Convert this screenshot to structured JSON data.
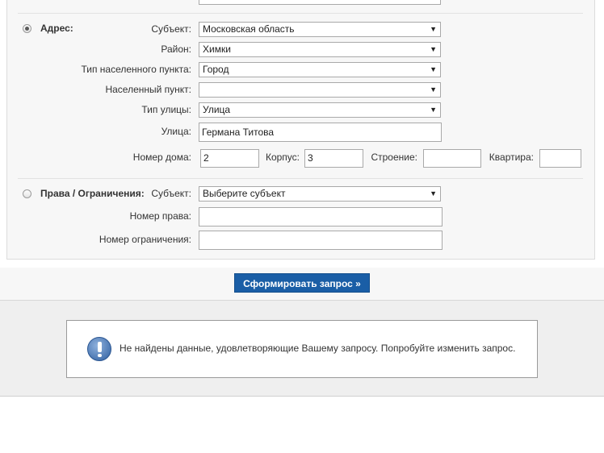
{
  "address": {
    "section_label": "Адрес:",
    "subject": {
      "label": "Субъект:",
      "value": "Московская область"
    },
    "district": {
      "label": "Район:",
      "value": "Химки"
    },
    "locality_type": {
      "label": "Тип населенного пункта:",
      "value": "Город"
    },
    "locality": {
      "label": "Населенный пункт:",
      "value": ""
    },
    "street_type": {
      "label": "Тип улицы:",
      "value": "Улица"
    },
    "street": {
      "label": "Улица:",
      "value": "Германа Титова"
    },
    "house": {
      "label": "Номер дома:",
      "value": "2"
    },
    "building": {
      "label": "Корпус:",
      "value": "3"
    },
    "structure": {
      "label": "Строение:",
      "value": ""
    },
    "apartment": {
      "label": "Квартира:",
      "value": ""
    }
  },
  "rights": {
    "section_label": "Права / Ограничения:",
    "subject": {
      "label": "Субъект:",
      "value": "Выберите субъект"
    },
    "right_number": {
      "label": "Номер права:",
      "value": ""
    },
    "restriction_number": {
      "label": "Номер ограничения:",
      "value": ""
    }
  },
  "submit_label": "Сформировать запрос »",
  "message": "Не найдены данные, удовлетворяющие Вашему запросу. Попробуйте изменить запрос.",
  "colors": {
    "button": "#1a5ea6",
    "panel": "#f7f7f7",
    "result_bg": "#efefef"
  }
}
